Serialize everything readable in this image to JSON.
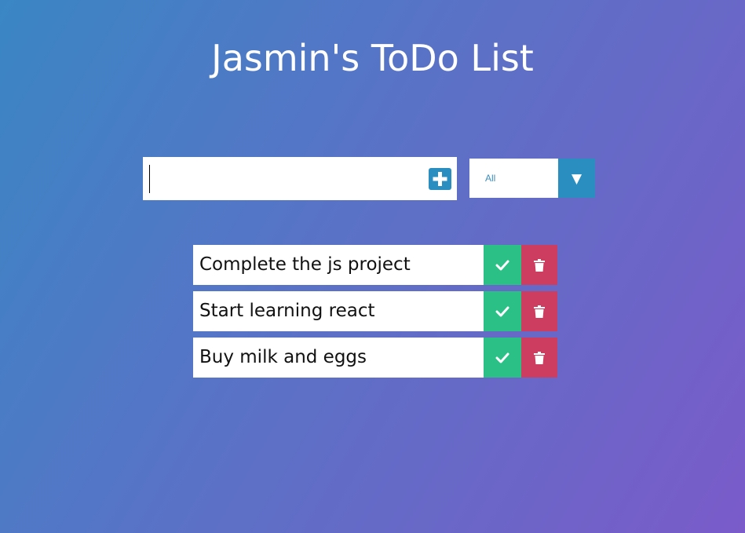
{
  "header": {
    "title": "Jasmin's ToDo List"
  },
  "form": {
    "input_value": "",
    "add_icon": "plus-square-icon",
    "filter": {
      "selected": "All",
      "arrow_icon": "triangle-down-icon"
    }
  },
  "todos": [
    {
      "text": "Complete the js project"
    },
    {
      "text": "Start learning react"
    },
    {
      "text": "Buy milk and eggs"
    }
  ],
  "icons": {
    "complete": "check-icon",
    "delete": "trash-icon"
  },
  "colors": {
    "gradient_start": "#3a86c4",
    "gradient_end": "#7a5bc9",
    "accent_blue": "#2b8ec0",
    "complete_green": "#2bc186",
    "delete_red": "#cc3d5f"
  }
}
